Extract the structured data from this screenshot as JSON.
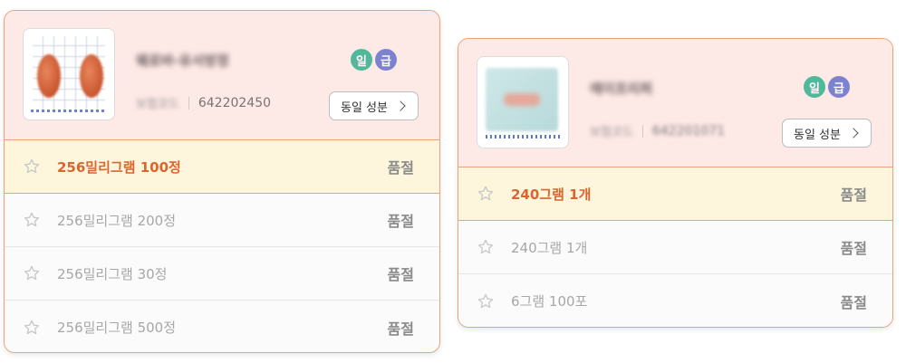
{
  "cards": [
    {
      "name": "웨로바-유서방정",
      "id_label": "보험코드",
      "code": "642202450",
      "badges": [
        "일",
        "급"
      ],
      "same_ingredient_label": "동일 성분",
      "options": [
        {
          "label": "256밀리그램 100정",
          "status": "품절",
          "selected": true
        },
        {
          "label": "256밀리그램 200정",
          "status": "품절",
          "selected": false
        },
        {
          "label": "256밀리그램 30정",
          "status": "품절",
          "selected": false
        },
        {
          "label": "256밀리그램 500정",
          "status": "품절",
          "selected": false
        }
      ]
    },
    {
      "name": "에이프리퍼",
      "id_label": "보험코드",
      "code": "642201071",
      "badges": [
        "일",
        "급"
      ],
      "same_ingredient_label": "동일 성분",
      "options": [
        {
          "label": "240그램 1개",
          "status": "품절",
          "selected": true
        },
        {
          "label": "240그램 1개",
          "status": "품절",
          "selected": false
        },
        {
          "label": "6그램 100포",
          "status": "품절",
          "selected": false
        }
      ]
    }
  ],
  "colors": {
    "accent": "#d9652f",
    "border": "#e8a37d",
    "header_bg": "#fde9e6",
    "selected_bg": "#fdf6dc",
    "badge_green": "#4fb99a",
    "badge_purple": "#7d82cf"
  },
  "icons": {
    "favorite": "star-outline-icon",
    "chevron": "chevron-right-icon"
  }
}
